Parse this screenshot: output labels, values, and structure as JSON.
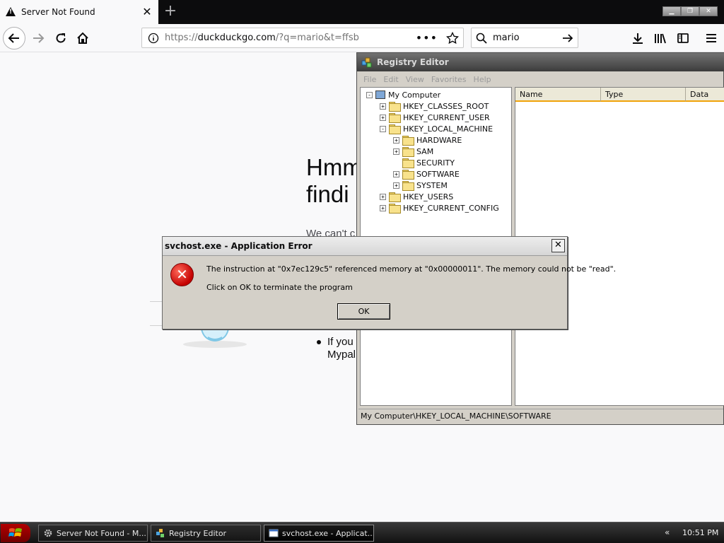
{
  "browser": {
    "tab_title": "Server Not Found",
    "url_prefix": "https://",
    "url_host": "duckduckgo.com",
    "url_path": "/?q=mario&t=ffsb",
    "search_value": "mario"
  },
  "page": {
    "heading_line1": "Hmm",
    "heading_line2": "findi",
    "partial_text": "We can't c",
    "bullet_line1": "If you",
    "bullet_line2": "Mypal"
  },
  "registry": {
    "title": "Registry Editor",
    "menu": [
      "File",
      "Edit",
      "View",
      "Favorites",
      "Help"
    ],
    "tree": [
      {
        "label": "My Computer",
        "level": 0,
        "expander": "-",
        "icon": "computer"
      },
      {
        "label": "HKEY_CLASSES_ROOT",
        "level": 1,
        "expander": "+",
        "icon": "folder"
      },
      {
        "label": "HKEY_CURRENT_USER",
        "level": 1,
        "expander": "+",
        "icon": "folder"
      },
      {
        "label": "HKEY_LOCAL_MACHINE",
        "level": 1,
        "expander": "-",
        "icon": "folder"
      },
      {
        "label": "HARDWARE",
        "level": 2,
        "expander": "+",
        "icon": "folder"
      },
      {
        "label": "SAM",
        "level": 2,
        "expander": "+",
        "icon": "folder"
      },
      {
        "label": "SECURITY",
        "level": 2,
        "expander": "",
        "icon": "folder"
      },
      {
        "label": "SOFTWARE",
        "level": 2,
        "expander": "+",
        "icon": "folder-open"
      },
      {
        "label": "SYSTEM",
        "level": 2,
        "expander": "+",
        "icon": "folder"
      },
      {
        "label": "HKEY_USERS",
        "level": 1,
        "expander": "+",
        "icon": "folder"
      },
      {
        "label": "HKEY_CURRENT_CONFIG",
        "level": 1,
        "expander": "+",
        "icon": "folder"
      }
    ],
    "columns": [
      "Name",
      "Type",
      "Data"
    ],
    "status_path": "My Computer\\HKEY_LOCAL_MACHINE\\SOFTWARE"
  },
  "dialog": {
    "title": "svchost.exe - Application Error",
    "message": "The instruction at \"0x7ec129c5\" referenced memory at \"0x00000011\". The memory could not be \"read\".",
    "message2": "Click on OK to terminate the program",
    "ok_label": "OK"
  },
  "taskbar": {
    "tasks": [
      {
        "label": "Server Not Found - M...",
        "icon": "gear-icon"
      },
      {
        "label": "Registry Editor",
        "icon": "registry-icon"
      },
      {
        "label": "svchost.exe - Applicat...",
        "icon": "window-icon"
      }
    ],
    "tray_arrows": "«",
    "clock": "10:51 PM"
  },
  "colors": {
    "error_red": "#c40000",
    "column_accent": "#f0a30a",
    "taskbar_bg": "#111111"
  }
}
